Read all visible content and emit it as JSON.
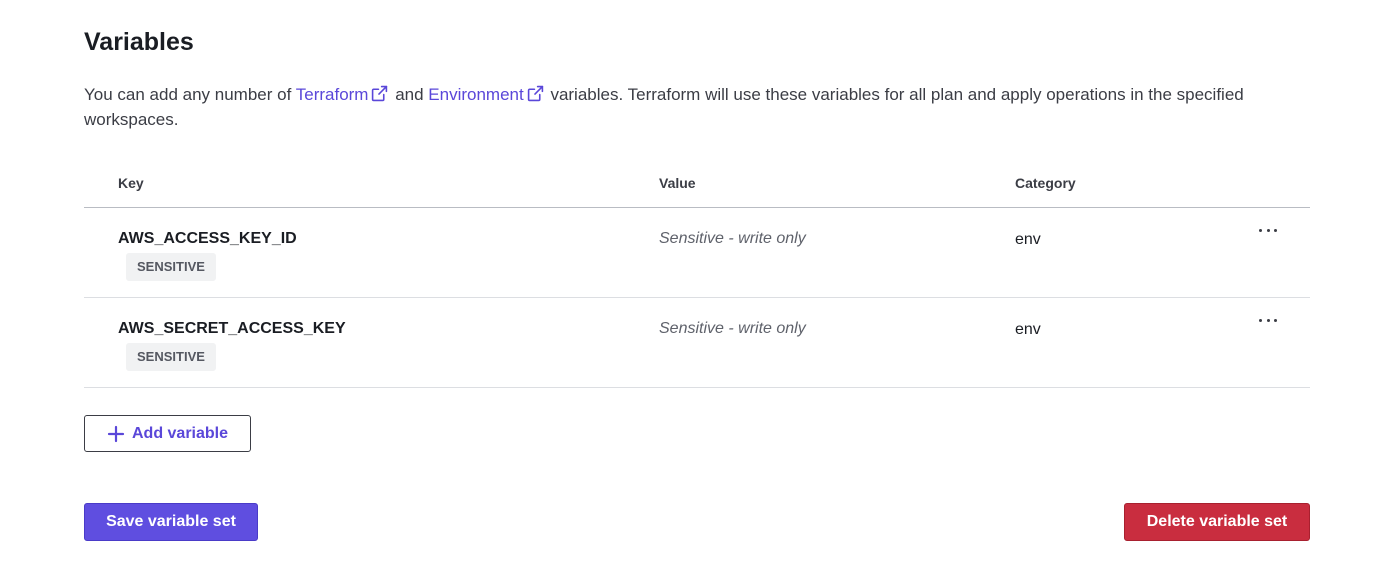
{
  "header": {
    "title": "Variables"
  },
  "description": {
    "prefix": "You can add any number of ",
    "link_terraform": "Terraform",
    "middle": " and ",
    "link_environment": "Environment",
    "suffix": " variables. Terraform will use these variables for all plan and apply operations in the specified workspaces."
  },
  "table": {
    "columns": {
      "key": "Key",
      "value": "Value",
      "category": "Category"
    },
    "rows": [
      {
        "key": "AWS_ACCESS_KEY_ID",
        "badge": "SENSITIVE",
        "value": "Sensitive - write only",
        "category": "env"
      },
      {
        "key": "AWS_SECRET_ACCESS_KEY",
        "badge": "SENSITIVE",
        "value": "Sensitive - write only",
        "category": "env"
      }
    ]
  },
  "actions": {
    "add_variable": "Add variable",
    "save": "Save variable set",
    "delete": "Delete variable set"
  },
  "icons": {
    "external_link": "external-link-icon",
    "plus": "plus-icon",
    "more": "ellipsis-icon"
  },
  "colors": {
    "link": "#5a47d9",
    "primary": "#5f4ee0",
    "danger": "#c92d3f",
    "badge_bg": "#f1f2f3"
  }
}
